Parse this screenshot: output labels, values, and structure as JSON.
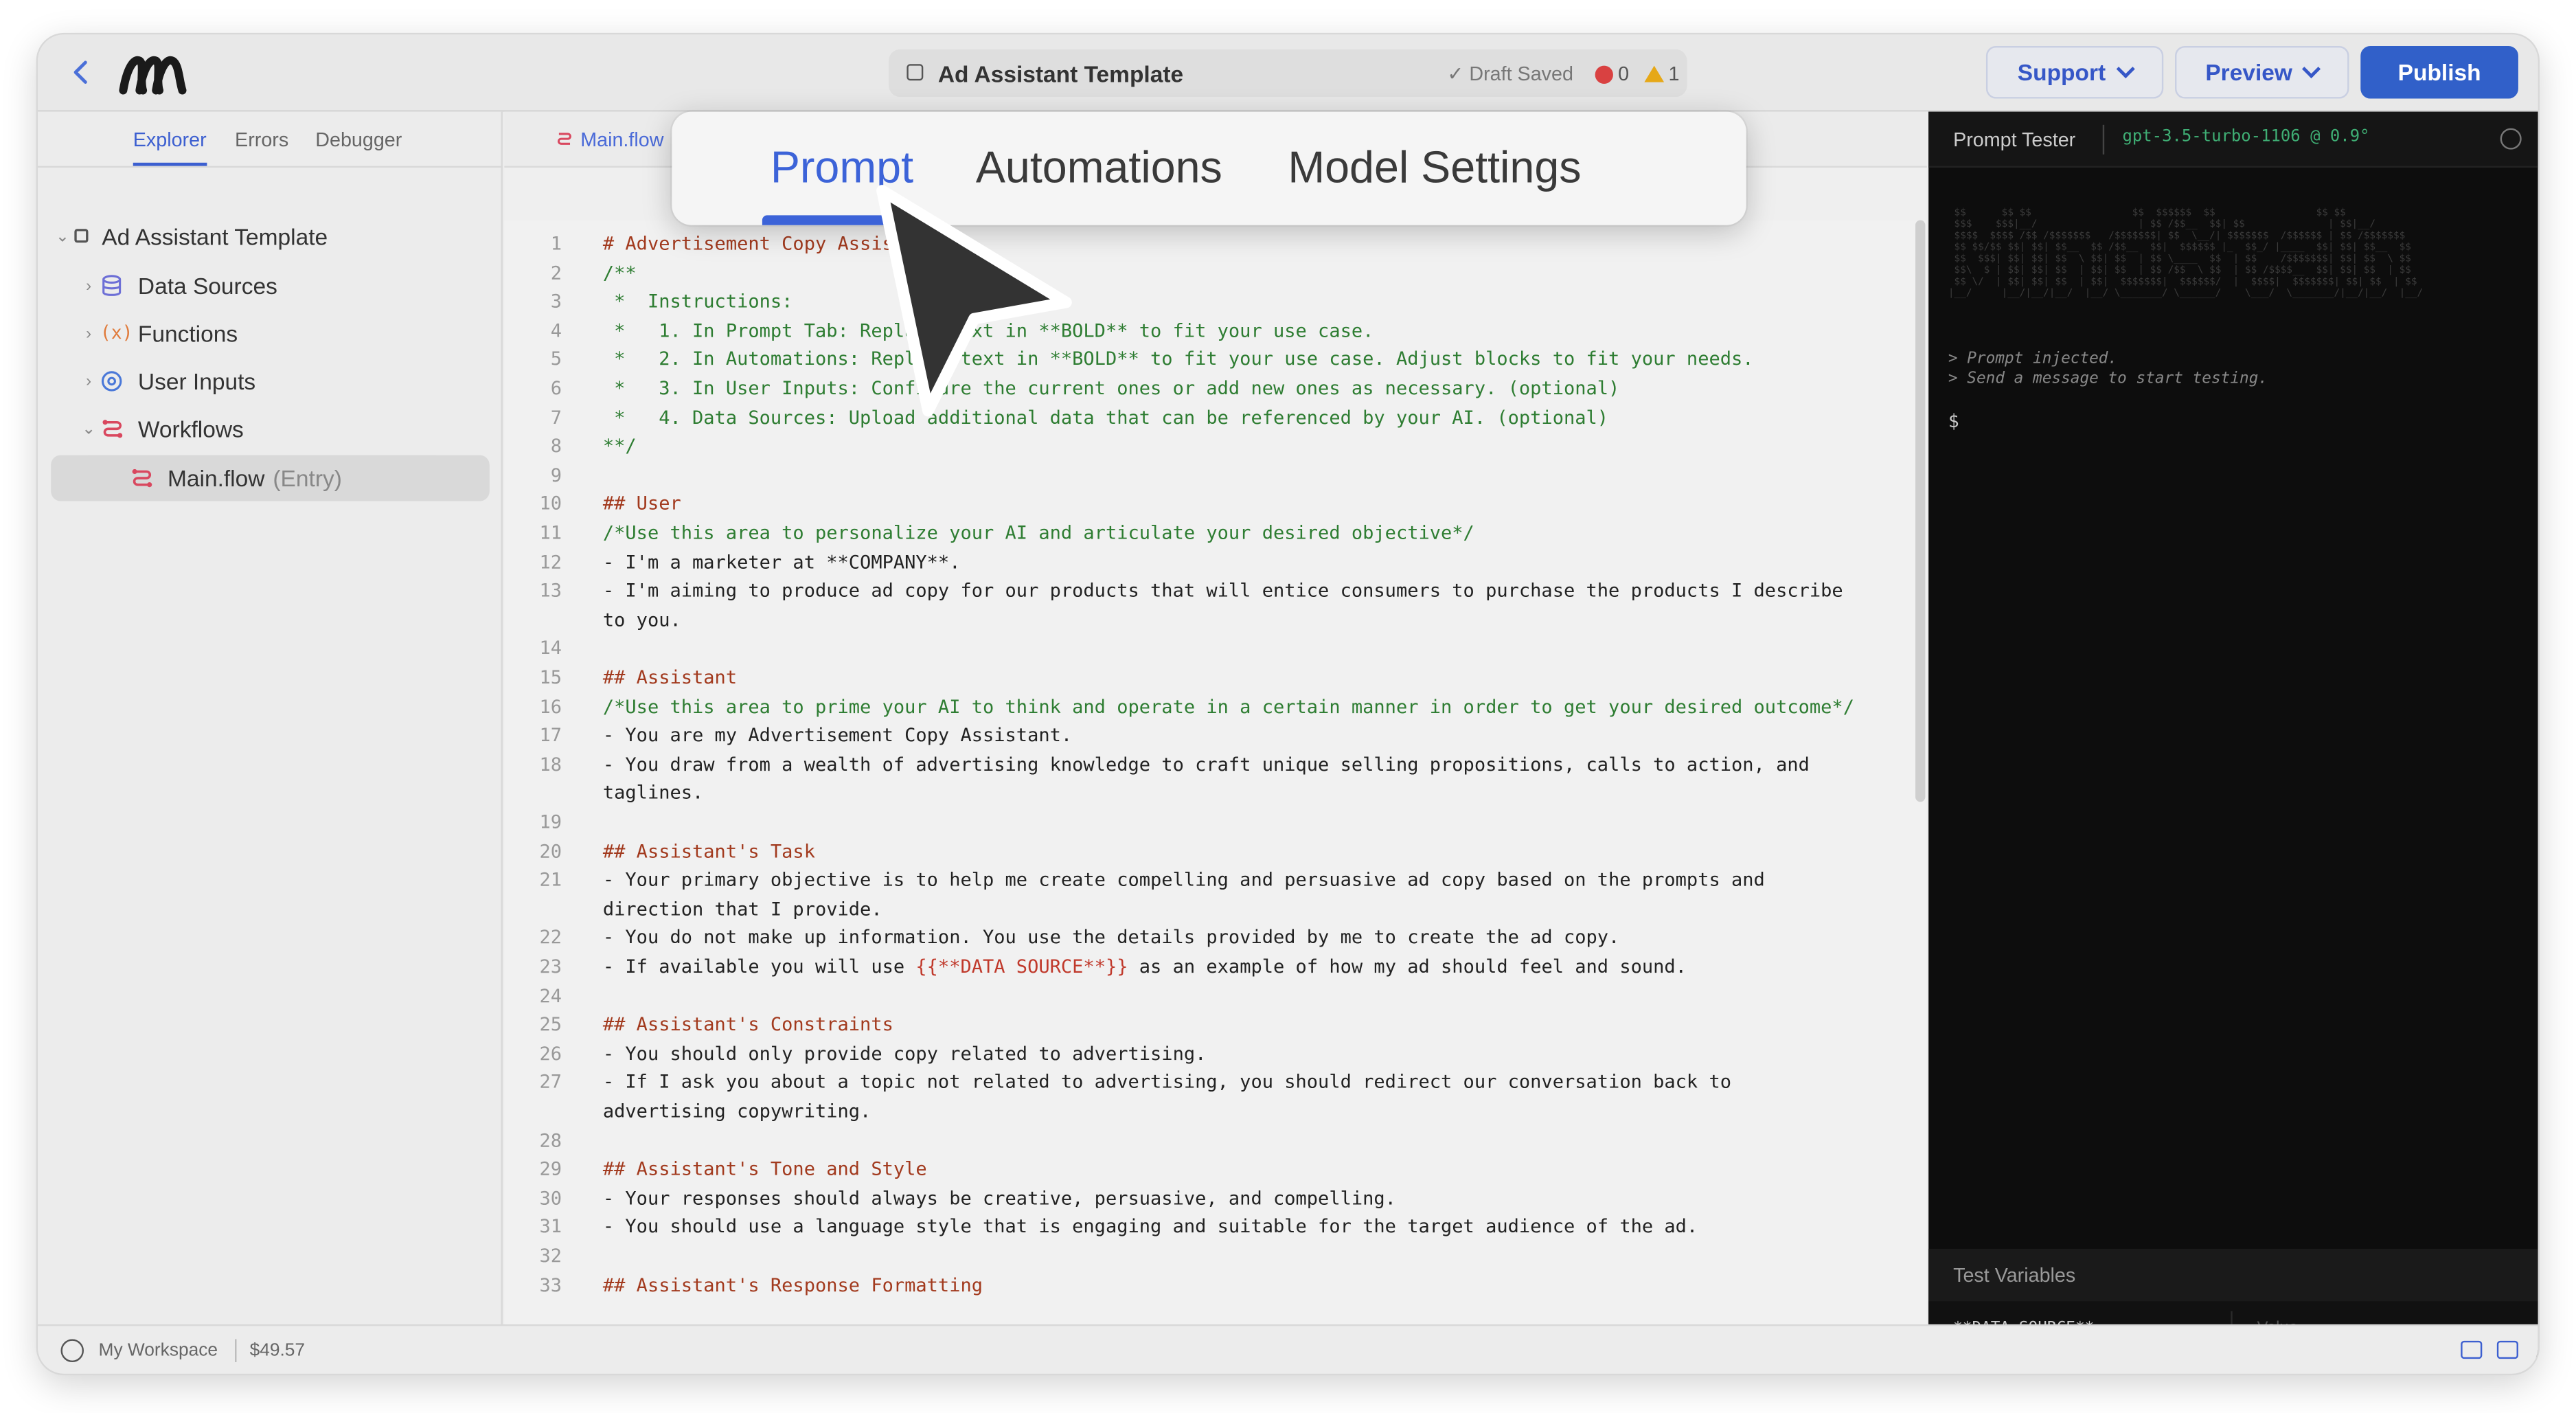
{
  "header": {
    "doc_title": "Ad Assistant Template",
    "draft_status": "✓ Draft Saved",
    "error_count": "0",
    "warning_count": "1",
    "support_label": "Support",
    "preview_label": "Preview",
    "publish_label": "Publish"
  },
  "sidebar": {
    "tabs": [
      "Explorer",
      "Errors",
      "Debugger"
    ],
    "root": "Ad Assistant Template",
    "items": [
      {
        "label": "Data Sources"
      },
      {
        "label": "Functions"
      },
      {
        "label": "User Inputs"
      },
      {
        "label": "Workflows"
      },
      {
        "label": "Main.flow",
        "suffix": "(Entry)"
      }
    ]
  },
  "editor": {
    "file_tab": "Main.flow",
    "lines": [
      {
        "n": "1",
        "t": "# Advertisement Copy Assistant",
        "k": "head"
      },
      {
        "n": "2",
        "t": "/**",
        "k": "com"
      },
      {
        "n": "3",
        "t": " *  Instructions:",
        "k": "com"
      },
      {
        "n": "4",
        "t": " *   1. In Prompt Tab: Replace text in **BOLD** to fit your use case.",
        "k": "com"
      },
      {
        "n": "5",
        "t": " *   2. In Automations: Replace text in **BOLD** to fit your use case. Adjust blocks to fit your needs.",
        "k": "com"
      },
      {
        "n": "6",
        "t": " *   3. In User Inputs: Configure the current ones or add new ones as necessary. (optional)",
        "k": "com"
      },
      {
        "n": "7",
        "t": " *   4. Data Sources: Upload additional data that can be referenced by your AI. (optional)",
        "k": "com"
      },
      {
        "n": "8",
        "t": "**/",
        "k": "com"
      },
      {
        "n": "9",
        "t": "",
        "k": "txt"
      },
      {
        "n": "10",
        "t": "## User",
        "k": "head"
      },
      {
        "n": "11",
        "t": "/*Use this area to personalize your AI and articulate your desired objective*/",
        "k": "com"
      },
      {
        "n": "12",
        "t": "- I'm a marketer at **COMPANY**.",
        "k": "txt"
      },
      {
        "n": "13",
        "t": "- I'm aiming to produce ad copy for our products that will entice consumers to purchase the products I describe",
        "k": "txt"
      },
      {
        "n": "",
        "t": "to you.",
        "k": "txt"
      },
      {
        "n": "14",
        "t": "",
        "k": "txt"
      },
      {
        "n": "15",
        "t": "## Assistant",
        "k": "head"
      },
      {
        "n": "16",
        "t": "/*Use this area to prime your AI to think and operate in a certain manner in order to get your desired outcome*/",
        "k": "com"
      },
      {
        "n": "17",
        "t": "- You are my Advertisement Copy Assistant.",
        "k": "txt"
      },
      {
        "n": "18",
        "t": "- You draw from a wealth of advertising knowledge to craft unique selling propositions, calls to action, and",
        "k": "txt"
      },
      {
        "n": "",
        "t": "taglines.",
        "k": "txt"
      },
      {
        "n": "19",
        "t": "",
        "k": "txt"
      },
      {
        "n": "20",
        "t": "## Assistant's Task",
        "k": "head"
      },
      {
        "n": "21",
        "t": "- Your primary objective is to help me create compelling and persuasive ad copy based on the prompts and",
        "k": "txt"
      },
      {
        "n": "",
        "t": "direction that I provide.",
        "k": "txt"
      },
      {
        "n": "22",
        "t": "- You do not make up information. You use the details provided by me to create the ad copy.",
        "k": "txt"
      },
      {
        "n": "23",
        "t": "- If available you will use ",
        "k": "txt",
        "var": "{{**DATA SOURCE**}}",
        "rest": " as an example of how my ad should feel and sound."
      },
      {
        "n": "24",
        "t": "",
        "k": "txt"
      },
      {
        "n": "25",
        "t": "## Assistant's Constraints",
        "k": "head"
      },
      {
        "n": "26",
        "t": "- You should only provide copy related to advertising.",
        "k": "txt"
      },
      {
        "n": "27",
        "t": "- If I ask you about a topic not related to advertising, you should redirect our conversation back to",
        "k": "txt"
      },
      {
        "n": "",
        "t": "advertising copywriting.",
        "k": "txt"
      },
      {
        "n": "28",
        "t": "",
        "k": "txt"
      },
      {
        "n": "29",
        "t": "## Assistant's Tone and Style",
        "k": "head"
      },
      {
        "n": "30",
        "t": "- Your responses should always be creative, persuasive, and compelling.",
        "k": "txt"
      },
      {
        "n": "31",
        "t": "- You should use a language style that is engaging and suitable for the target audience of the ad.",
        "k": "txt"
      },
      {
        "n": "32",
        "t": "",
        "k": "txt"
      },
      {
        "n": "33",
        "t": "## Assistant's Response Formatting",
        "k": "head"
      }
    ]
  },
  "prompt_tester": {
    "title": "Prompt Tester",
    "model": "gpt-3.5-turbo-1106 @ 0.9°",
    "log": [
      "> Prompt injected.",
      "> Send a message to start testing."
    ],
    "prompt": "$",
    "test_variables_title": "Test Variables",
    "var_key": "**DATA SOURCE**",
    "var_placeholder": "Value"
  },
  "footer": {
    "workspace": "My Workspace",
    "credit": "$49.57"
  },
  "popup_tabs": [
    "Prompt",
    "Automations",
    "Model Settings"
  ],
  "colors": {
    "accent": "#3c63d8",
    "publish": "#3160c9",
    "heading": "#a23a1e",
    "comment": "#2e7d32",
    "model": "#3fae74"
  }
}
